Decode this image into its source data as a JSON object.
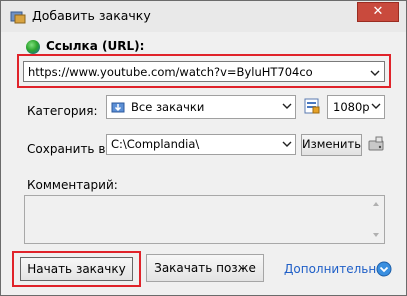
{
  "window": {
    "title": "Добавить закачку",
    "close_glyph": "✕"
  },
  "url": {
    "label": "Ссылка (URL):",
    "value": "https://www.youtube.com/watch?v=ByluHT704co"
  },
  "category": {
    "label": "Категория:",
    "value": "Все закачки"
  },
  "quality": {
    "value": "1080p"
  },
  "save": {
    "label": "Сохранить в:",
    "path": "C:\\Complandia\\",
    "change_label": "Изменить"
  },
  "comment": {
    "label": "Комментарий:",
    "value": ""
  },
  "buttons": {
    "start_label": "Начать закачку",
    "later_label": "Закачать позже",
    "more_label": "Дополнительно"
  },
  "colors": {
    "highlight": "#e0232a",
    "link": "#1f5fc7",
    "close": "#c94a3d"
  }
}
